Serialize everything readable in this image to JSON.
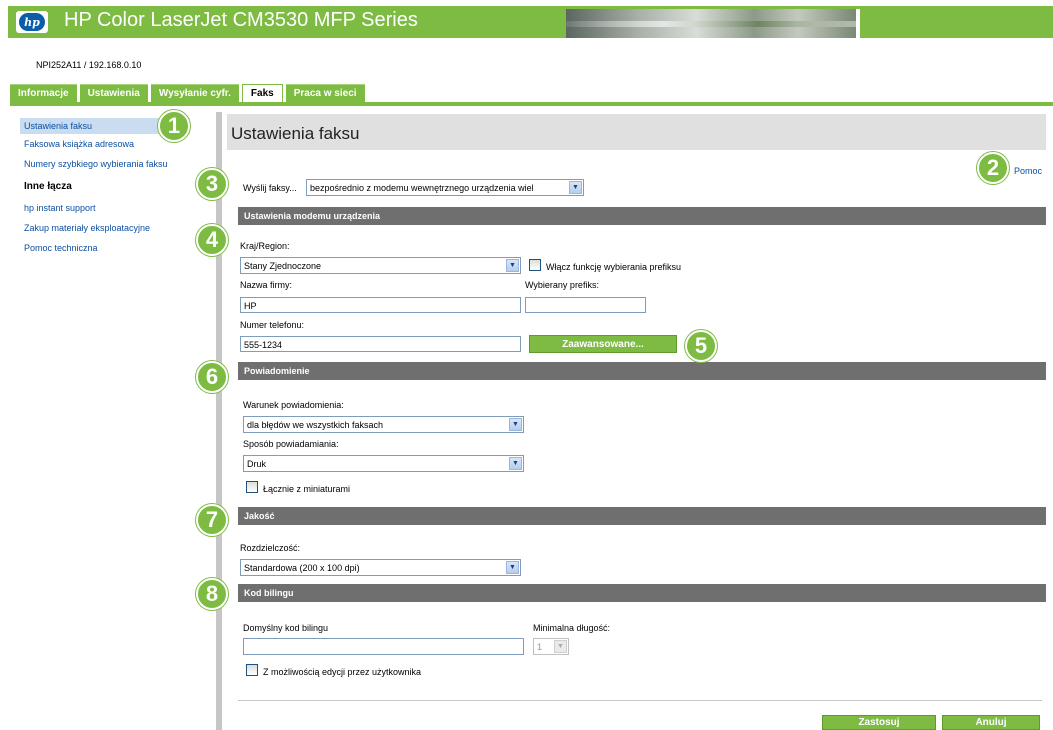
{
  "header": {
    "logo_text": "hp",
    "app_title": "HP Color LaserJet CM3530 MFP Series",
    "device_id": "NPI252A11 / 192.168.0.10"
  },
  "tabs": [
    {
      "label": "Informacje"
    },
    {
      "label": "Ustawienia"
    },
    {
      "label": "Wysyłanie cyfr."
    },
    {
      "label": "Faks"
    },
    {
      "label": "Praca w sieci"
    }
  ],
  "sidebar": {
    "items": [
      {
        "label": "Ustawienia faksu"
      },
      {
        "label": "Faksowa książka adresowa"
      },
      {
        "label": "Numery szybkiego wybierania faksu"
      }
    ],
    "other_links_heading": "Inne łącza",
    "other_links": [
      {
        "label": "hp instant support"
      },
      {
        "label": "Zakup materiały eksploatacyjne"
      },
      {
        "label": "Pomoc techniczna"
      }
    ]
  },
  "main": {
    "page_title": "Ustawienia faksu",
    "help_link": "Pomoc",
    "send_fax_label": "Wyślij faksy...",
    "send_fax_value": "bezpośrednio z modemu wewnętrznego urządzenia wiel",
    "modem_section": {
      "title": "Ustawienia modemu urządzenia",
      "country_label": "Kraj/Region:",
      "country_value": "Stany Zjednoczone",
      "prefix_toggle_label": "Włącz funkcję wybierania prefiksu",
      "company_label": "Nazwa firmy:",
      "company_value": "HP",
      "prefix_label": "Wybierany prefiks:",
      "prefix_value": "",
      "phone_label": "Numer telefonu:",
      "phone_value": "555-1234",
      "advanced_button": "Zaawansowane..."
    },
    "notification_section": {
      "title": "Powiadomienie",
      "condition_label": "Warunek powiadomienia:",
      "condition_value": "dla błędów we wszystkich faksach",
      "method_label": "Sposób powiadamiania:",
      "method_value": "Druk",
      "thumbnails_label": "Łącznie z miniaturami"
    },
    "quality_section": {
      "title": "Jakość",
      "resolution_label": "Rozdzielczość:",
      "resolution_value": "Standardowa (200 x 100 dpi)"
    },
    "billing_section": {
      "title": "Kod bilingu",
      "default_code_label": "Domyślny kod bilingu",
      "default_code_value": "",
      "min_length_label": "Minimalna długość:",
      "min_length_value": "1",
      "user_editable_label": "Z możliwością edycji przez użytkownika"
    },
    "apply_button": "Zastosuj",
    "cancel_button": "Anuluj"
  },
  "callouts": [
    "1",
    "2",
    "3",
    "4",
    "5",
    "6",
    "7",
    "8"
  ],
  "colors": {
    "accent_green": "#7dbb42",
    "section_gray": "#6f6f6f",
    "link_blue": "#0c4fa3"
  }
}
